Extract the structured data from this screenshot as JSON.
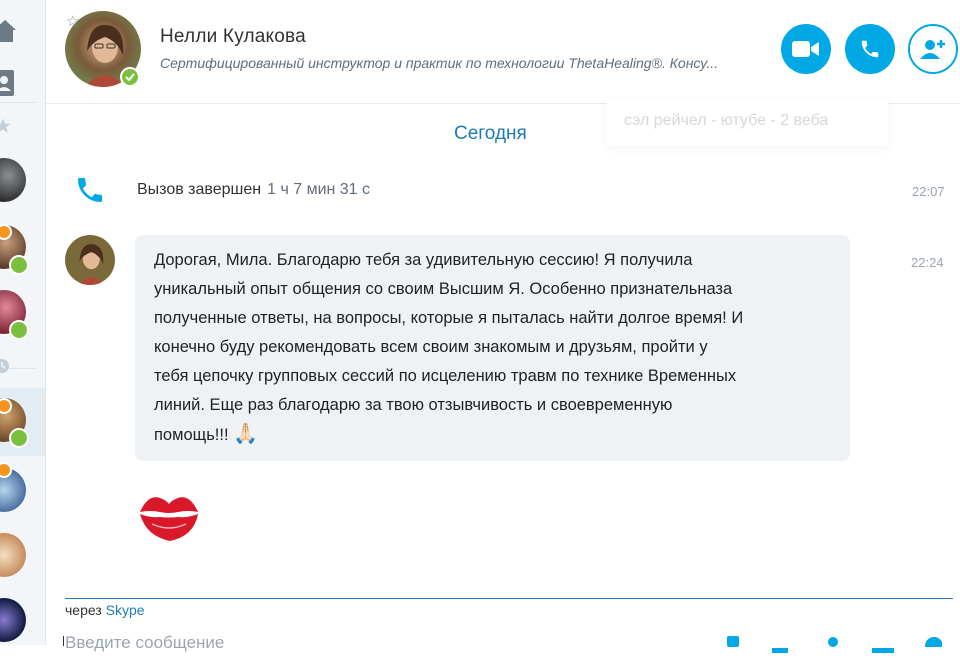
{
  "header": {
    "contact_name": "Нелли Кулакова",
    "mood_message": "Сертифицированный инструктор и практик по технологии ThetaHealing®. Консу...",
    "buttons": {
      "video": "video-call",
      "audio": "audio-call",
      "add": "add-person"
    },
    "accent_color": "#00a8e6"
  },
  "chat": {
    "ghost_search": "сэл рейчел - ютубе - 2 веба",
    "date_separator": "Сегодня",
    "call_event": {
      "label": "Вызов завершен",
      "duration": "1 ч 7 мин 31 с",
      "time": "22:07"
    },
    "message": {
      "time": "22:24",
      "text": "Дорогая, Мила. Благодарю тебя за удивительную сессию! Я получила\nуникальный опыт общения со своим Высшим Я. Особенно признательназа\nполученные ответы, на вопросы, которые я пыталась найти долгое время! И\nконечно буду рекомендовать всем своим знакомым и друзьям, пройти у\nтебя цепочку групповых сессий по исцелению травм по технике Временных\nлиний. Еще раз благодарю за твою отзывчивость и своевременную\nпомощь!!! ",
      "emoji": "🙏🏻"
    }
  },
  "composer": {
    "via_prefix": "через",
    "via_link": "Skype",
    "placeholder": "Введите сообщение"
  }
}
